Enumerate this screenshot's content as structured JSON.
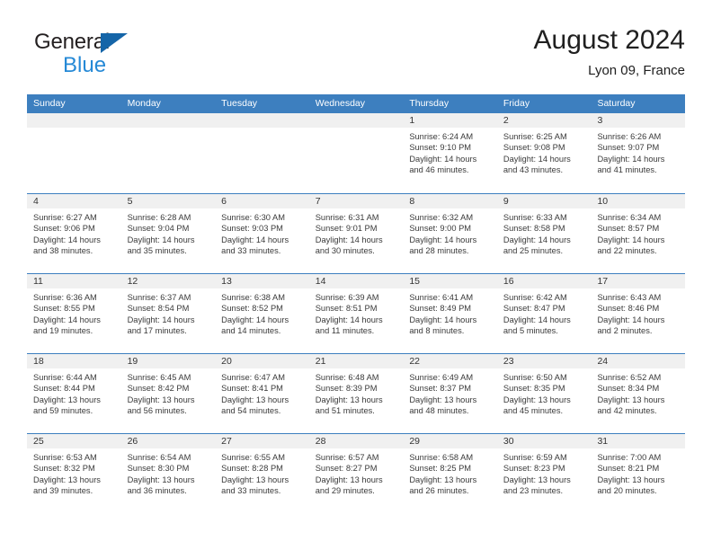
{
  "brand": {
    "name_part1": "General",
    "name_part2": "Blue",
    "triangle_icon": "triangle-icon",
    "accent_dark": "#1565a8",
    "accent_light": "#2589d6"
  },
  "header": {
    "title": "August 2024",
    "subtitle": "Lyon 09, France"
  },
  "calendar": {
    "header_color": "#3d7fbf",
    "weekdays": [
      "Sunday",
      "Monday",
      "Tuesday",
      "Wednesday",
      "Thursday",
      "Friday",
      "Saturday"
    ],
    "weeks": [
      [
        {
          "day": "",
          "sunrise": "",
          "sunset": "",
          "daylight": "",
          "daylight2": ""
        },
        {
          "day": "",
          "sunrise": "",
          "sunset": "",
          "daylight": "",
          "daylight2": ""
        },
        {
          "day": "",
          "sunrise": "",
          "sunset": "",
          "daylight": "",
          "daylight2": ""
        },
        {
          "day": "",
          "sunrise": "",
          "sunset": "",
          "daylight": "",
          "daylight2": ""
        },
        {
          "day": "1",
          "sunrise": "Sunrise: 6:24 AM",
          "sunset": "Sunset: 9:10 PM",
          "daylight": "Daylight: 14 hours",
          "daylight2": "and 46 minutes."
        },
        {
          "day": "2",
          "sunrise": "Sunrise: 6:25 AM",
          "sunset": "Sunset: 9:08 PM",
          "daylight": "Daylight: 14 hours",
          "daylight2": "and 43 minutes."
        },
        {
          "day": "3",
          "sunrise": "Sunrise: 6:26 AM",
          "sunset": "Sunset: 9:07 PM",
          "daylight": "Daylight: 14 hours",
          "daylight2": "and 41 minutes."
        }
      ],
      [
        {
          "day": "4",
          "sunrise": "Sunrise: 6:27 AM",
          "sunset": "Sunset: 9:06 PM",
          "daylight": "Daylight: 14 hours",
          "daylight2": "and 38 minutes."
        },
        {
          "day": "5",
          "sunrise": "Sunrise: 6:28 AM",
          "sunset": "Sunset: 9:04 PM",
          "daylight": "Daylight: 14 hours",
          "daylight2": "and 35 minutes."
        },
        {
          "day": "6",
          "sunrise": "Sunrise: 6:30 AM",
          "sunset": "Sunset: 9:03 PM",
          "daylight": "Daylight: 14 hours",
          "daylight2": "and 33 minutes."
        },
        {
          "day": "7",
          "sunrise": "Sunrise: 6:31 AM",
          "sunset": "Sunset: 9:01 PM",
          "daylight": "Daylight: 14 hours",
          "daylight2": "and 30 minutes."
        },
        {
          "day": "8",
          "sunrise": "Sunrise: 6:32 AM",
          "sunset": "Sunset: 9:00 PM",
          "daylight": "Daylight: 14 hours",
          "daylight2": "and 28 minutes."
        },
        {
          "day": "9",
          "sunrise": "Sunrise: 6:33 AM",
          "sunset": "Sunset: 8:58 PM",
          "daylight": "Daylight: 14 hours",
          "daylight2": "and 25 minutes."
        },
        {
          "day": "10",
          "sunrise": "Sunrise: 6:34 AM",
          "sunset": "Sunset: 8:57 PM",
          "daylight": "Daylight: 14 hours",
          "daylight2": "and 22 minutes."
        }
      ],
      [
        {
          "day": "11",
          "sunrise": "Sunrise: 6:36 AM",
          "sunset": "Sunset: 8:55 PM",
          "daylight": "Daylight: 14 hours",
          "daylight2": "and 19 minutes."
        },
        {
          "day": "12",
          "sunrise": "Sunrise: 6:37 AM",
          "sunset": "Sunset: 8:54 PM",
          "daylight": "Daylight: 14 hours",
          "daylight2": "and 17 minutes."
        },
        {
          "day": "13",
          "sunrise": "Sunrise: 6:38 AM",
          "sunset": "Sunset: 8:52 PM",
          "daylight": "Daylight: 14 hours",
          "daylight2": "and 14 minutes."
        },
        {
          "day": "14",
          "sunrise": "Sunrise: 6:39 AM",
          "sunset": "Sunset: 8:51 PM",
          "daylight": "Daylight: 14 hours",
          "daylight2": "and 11 minutes."
        },
        {
          "day": "15",
          "sunrise": "Sunrise: 6:41 AM",
          "sunset": "Sunset: 8:49 PM",
          "daylight": "Daylight: 14 hours",
          "daylight2": "and 8 minutes."
        },
        {
          "day": "16",
          "sunrise": "Sunrise: 6:42 AM",
          "sunset": "Sunset: 8:47 PM",
          "daylight": "Daylight: 14 hours",
          "daylight2": "and 5 minutes."
        },
        {
          "day": "17",
          "sunrise": "Sunrise: 6:43 AM",
          "sunset": "Sunset: 8:46 PM",
          "daylight": "Daylight: 14 hours",
          "daylight2": "and 2 minutes."
        }
      ],
      [
        {
          "day": "18",
          "sunrise": "Sunrise: 6:44 AM",
          "sunset": "Sunset: 8:44 PM",
          "daylight": "Daylight: 13 hours",
          "daylight2": "and 59 minutes."
        },
        {
          "day": "19",
          "sunrise": "Sunrise: 6:45 AM",
          "sunset": "Sunset: 8:42 PM",
          "daylight": "Daylight: 13 hours",
          "daylight2": "and 56 minutes."
        },
        {
          "day": "20",
          "sunrise": "Sunrise: 6:47 AM",
          "sunset": "Sunset: 8:41 PM",
          "daylight": "Daylight: 13 hours",
          "daylight2": "and 54 minutes."
        },
        {
          "day": "21",
          "sunrise": "Sunrise: 6:48 AM",
          "sunset": "Sunset: 8:39 PM",
          "daylight": "Daylight: 13 hours",
          "daylight2": "and 51 minutes."
        },
        {
          "day": "22",
          "sunrise": "Sunrise: 6:49 AM",
          "sunset": "Sunset: 8:37 PM",
          "daylight": "Daylight: 13 hours",
          "daylight2": "and 48 minutes."
        },
        {
          "day": "23",
          "sunrise": "Sunrise: 6:50 AM",
          "sunset": "Sunset: 8:35 PM",
          "daylight": "Daylight: 13 hours",
          "daylight2": "and 45 minutes."
        },
        {
          "day": "24",
          "sunrise": "Sunrise: 6:52 AM",
          "sunset": "Sunset: 8:34 PM",
          "daylight": "Daylight: 13 hours",
          "daylight2": "and 42 minutes."
        }
      ],
      [
        {
          "day": "25",
          "sunrise": "Sunrise: 6:53 AM",
          "sunset": "Sunset: 8:32 PM",
          "daylight": "Daylight: 13 hours",
          "daylight2": "and 39 minutes."
        },
        {
          "day": "26",
          "sunrise": "Sunrise: 6:54 AM",
          "sunset": "Sunset: 8:30 PM",
          "daylight": "Daylight: 13 hours",
          "daylight2": "and 36 minutes."
        },
        {
          "day": "27",
          "sunrise": "Sunrise: 6:55 AM",
          "sunset": "Sunset: 8:28 PM",
          "daylight": "Daylight: 13 hours",
          "daylight2": "and 33 minutes."
        },
        {
          "day": "28",
          "sunrise": "Sunrise: 6:57 AM",
          "sunset": "Sunset: 8:27 PM",
          "daylight": "Daylight: 13 hours",
          "daylight2": "and 29 minutes."
        },
        {
          "day": "29",
          "sunrise": "Sunrise: 6:58 AM",
          "sunset": "Sunset: 8:25 PM",
          "daylight": "Daylight: 13 hours",
          "daylight2": "and 26 minutes."
        },
        {
          "day": "30",
          "sunrise": "Sunrise: 6:59 AM",
          "sunset": "Sunset: 8:23 PM",
          "daylight": "Daylight: 13 hours",
          "daylight2": "and 23 minutes."
        },
        {
          "day": "31",
          "sunrise": "Sunrise: 7:00 AM",
          "sunset": "Sunset: 8:21 PM",
          "daylight": "Daylight: 13 hours",
          "daylight2": "and 20 minutes."
        }
      ]
    ]
  }
}
